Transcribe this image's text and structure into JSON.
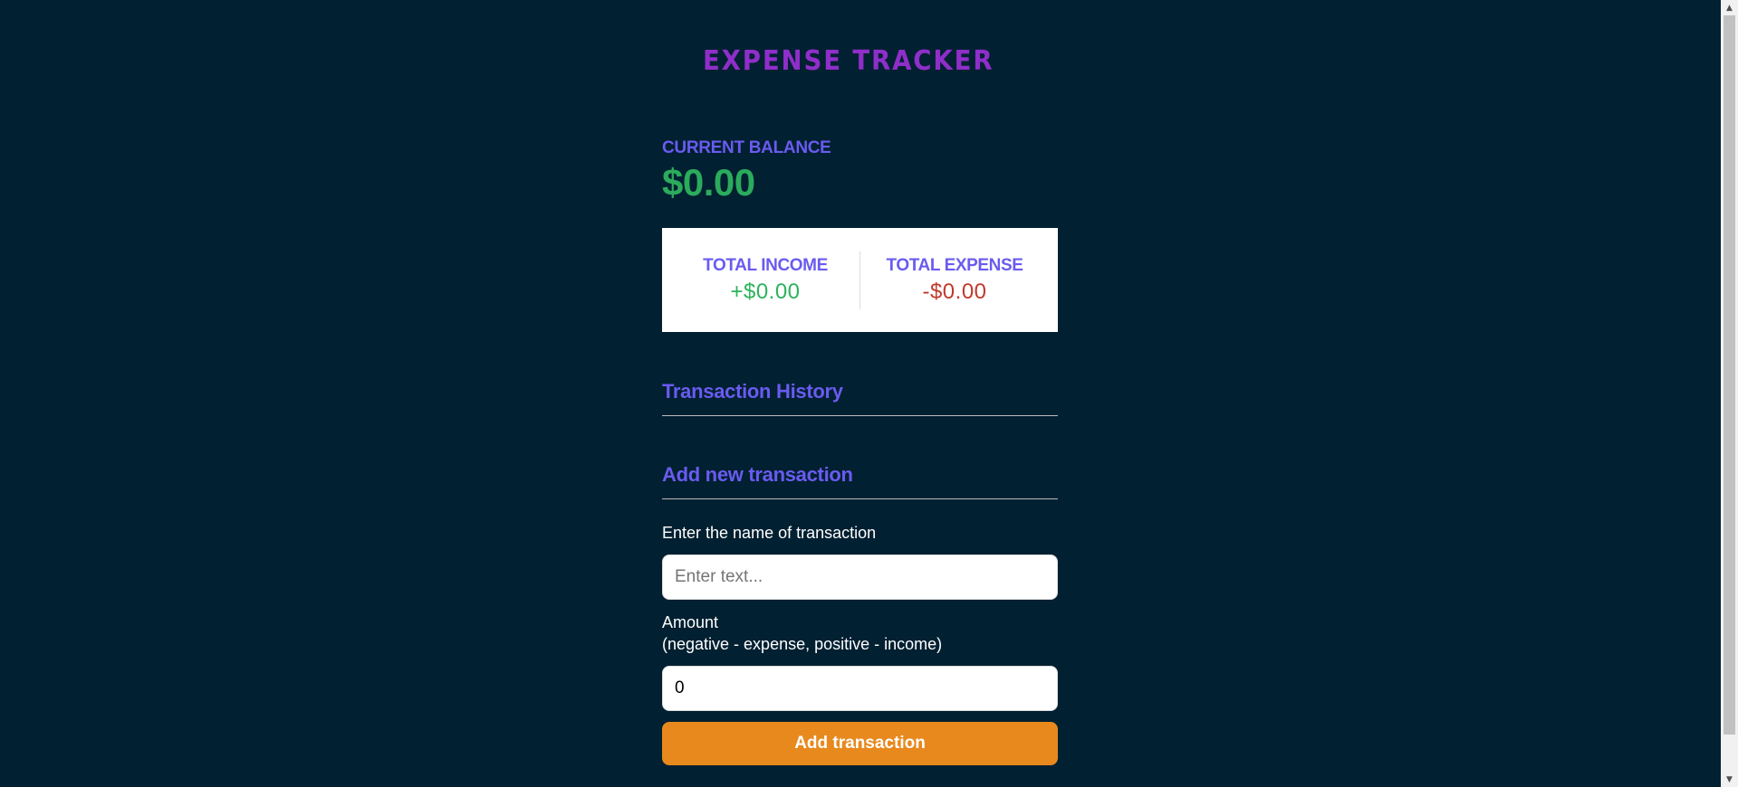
{
  "header": {
    "title": "EXPENSE TRACKER"
  },
  "balance": {
    "label": "CURRENT BALANCE",
    "value": "$0.00"
  },
  "summary": {
    "income_label": "TOTAL INCOME",
    "income_value": "+$0.00",
    "expense_label": "TOTAL EXPENSE",
    "expense_value": "-$0.00"
  },
  "history": {
    "title": "Transaction History",
    "items": []
  },
  "form": {
    "title": "Add new transaction",
    "text_label": "Enter the name of transaction",
    "text_placeholder": "Enter text...",
    "text_value": "",
    "amount_label_line1": "Amount",
    "amount_label_line2": "(negative - expense, positive - income)",
    "amount_value": "0",
    "submit_label": "Add transaction"
  },
  "colors": {
    "background": "#012031",
    "title": "#8f2ec9",
    "accent": "#6a5bf0",
    "positive": "#2bb35b",
    "negative": "#c0392b",
    "button": "#e8891d"
  },
  "icons": {
    "scroll_up": "triangle-up-icon",
    "scroll_down": "triangle-down-icon"
  }
}
